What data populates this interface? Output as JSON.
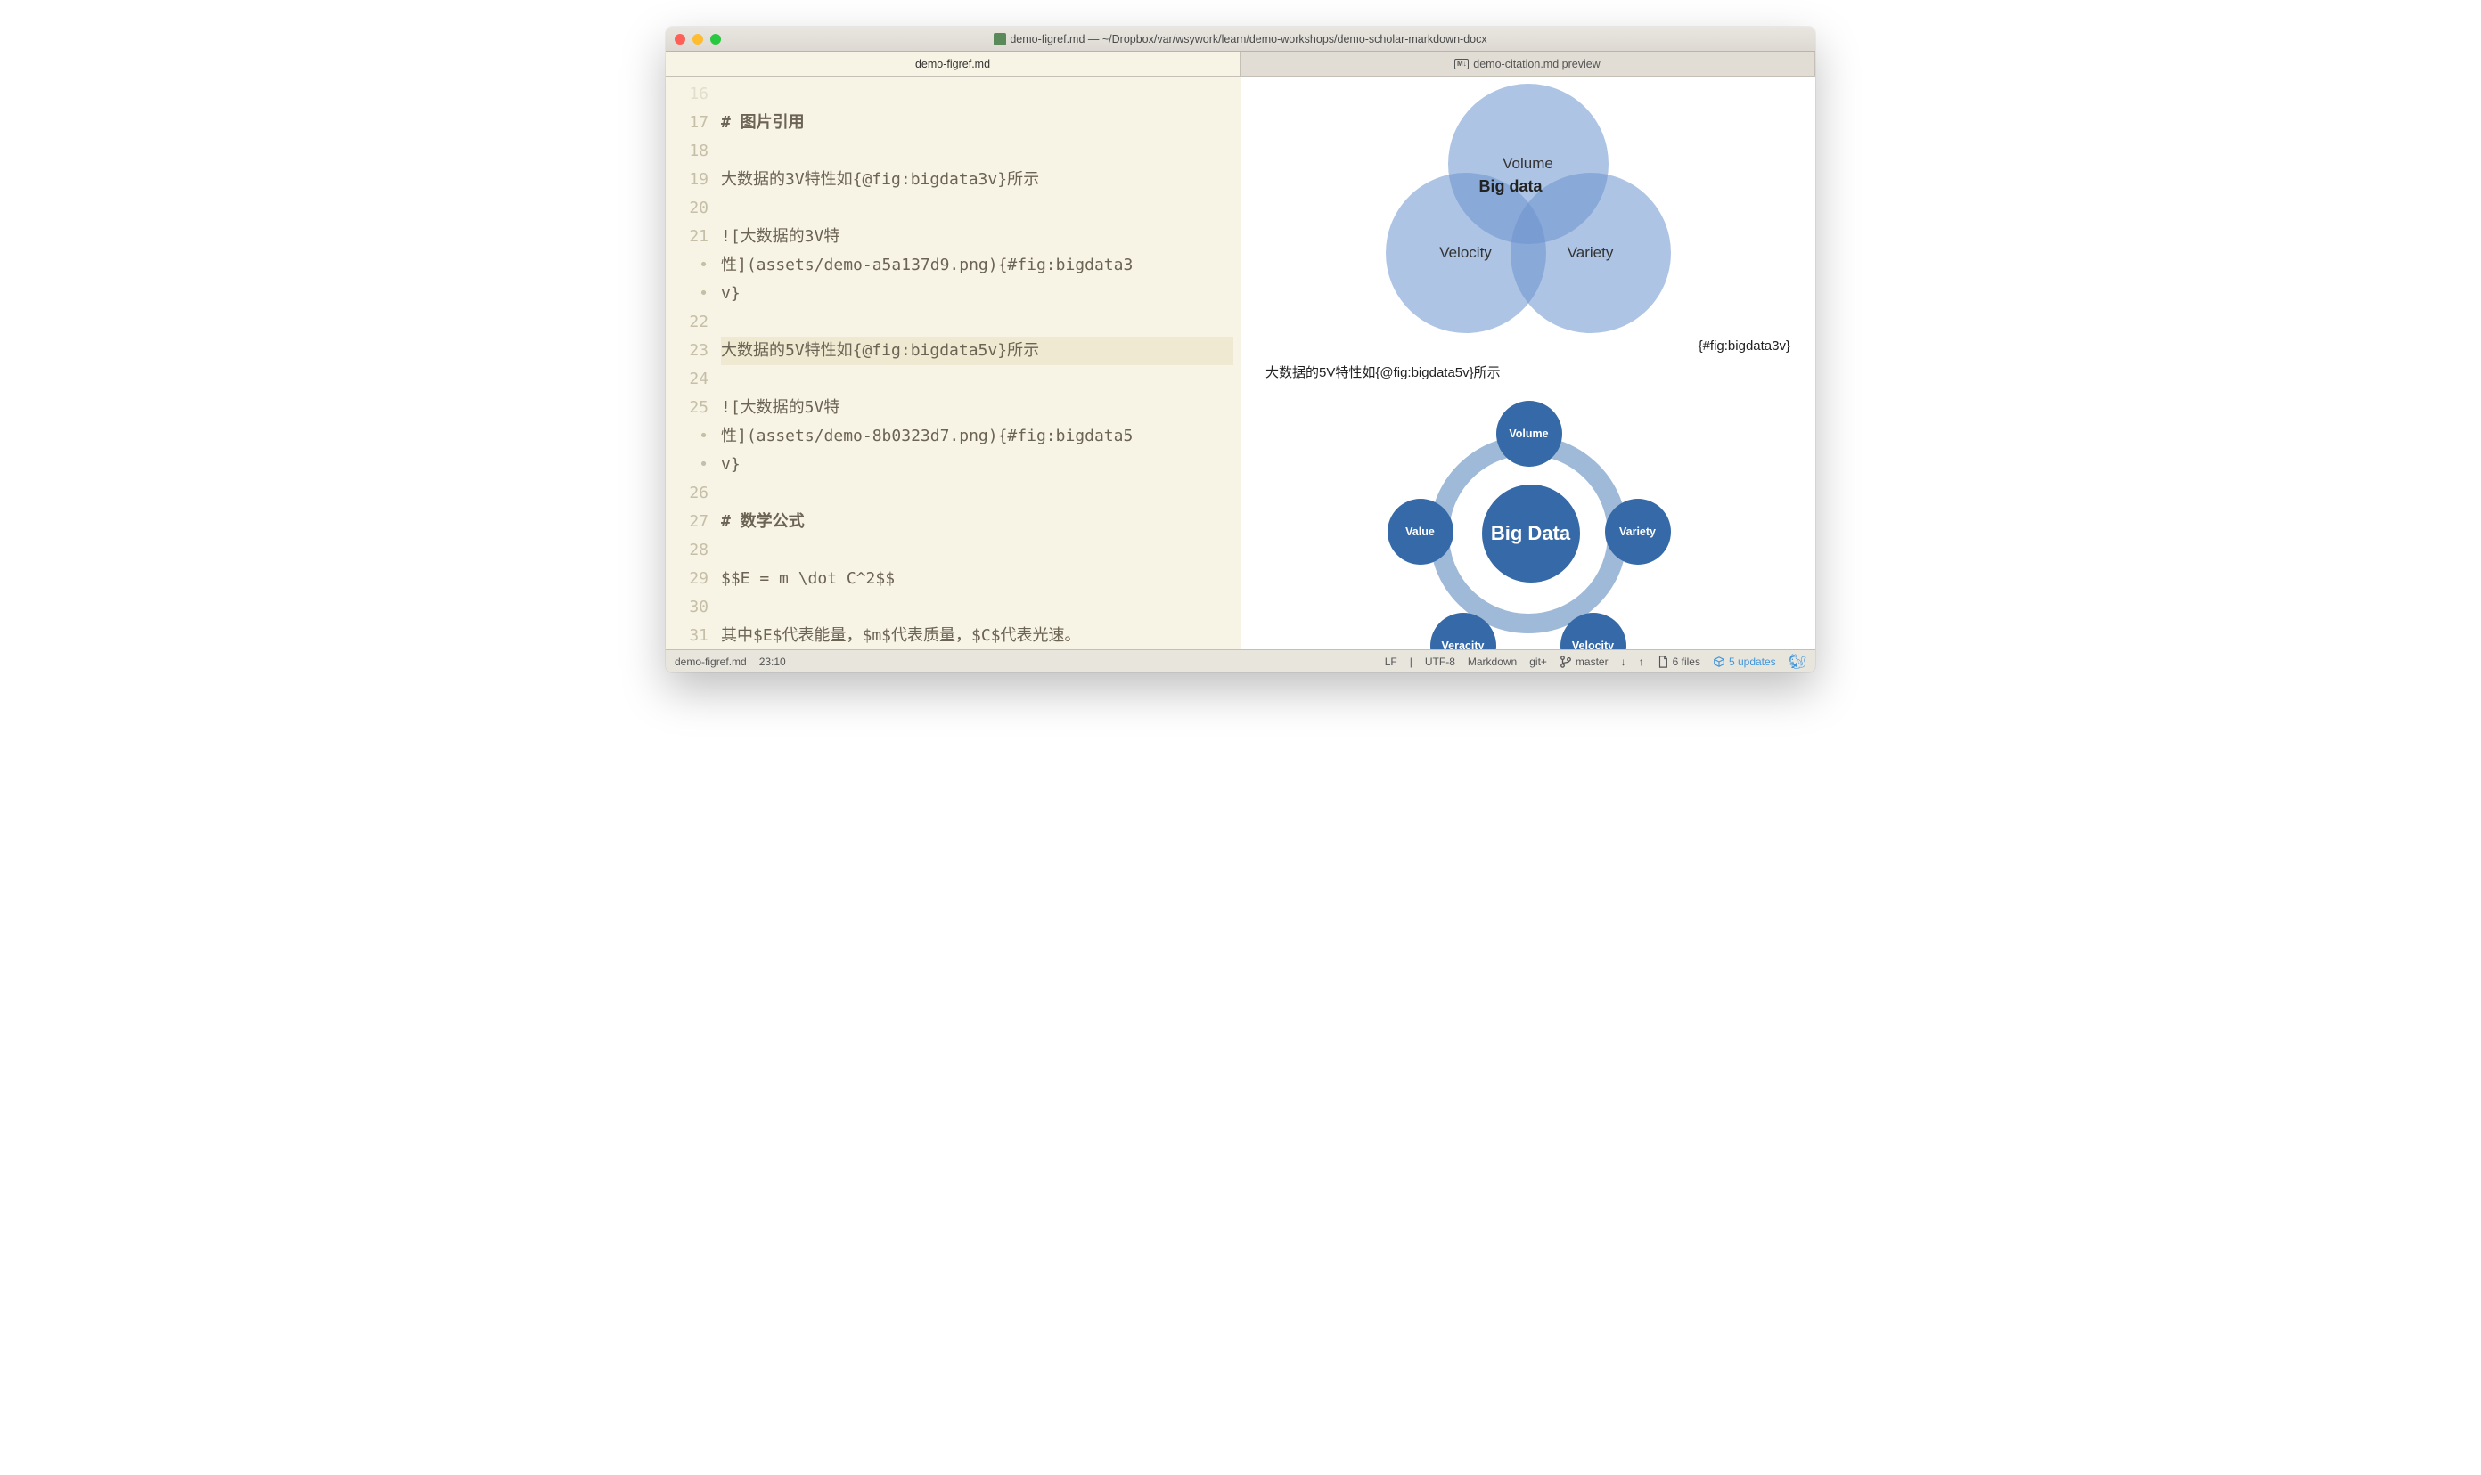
{
  "window": {
    "title": "demo-figref.md — ~/Dropbox/var/wsywork/learn/demo-workshops/demo-scholar-markdown-docx"
  },
  "tabs": {
    "left": "demo-figref.md",
    "right": "demo-citation.md preview"
  },
  "editor": {
    "gutter": [
      "16",
      "17",
      "18",
      "19",
      "20",
      "21",
      "•",
      "•",
      "22",
      "23",
      "24",
      "25",
      "•",
      "•",
      "26",
      "27",
      "28",
      "29",
      "30",
      "31"
    ],
    "line16_num": "16",
    "l17": "#  图片引用",
    "l19": "大数据的3V特性如{@fig:bigdata3v}所示",
    "l21a": "![大数据的3V特",
    "l21b": "性](assets/demo-a5a137d9.png){#fig:bigdata3",
    "l21c": "v}",
    "l23": "大数据的5V特性如{@fig:bigdata5v}所示",
    "l25a": "![大数据的5V特",
    "l25b": "性](assets/demo-8b0323d7.png){#fig:bigdata5",
    "l25c": "v}",
    "l27": "#  数学公式",
    "l29": "$$E = m \\dot C^2$$",
    "l31": "其中$E$代表能量，$m$代表质量，$C$代表光速。"
  },
  "preview": {
    "venn": {
      "c1": "Volume",
      "c2": "Velocity",
      "c3": "Variety",
      "center": "Big data"
    },
    "figtag": "{#fig:bigdata3v}",
    "text5v": "大数据的5V特性如{@fig:bigdata5v}所示",
    "wheel": {
      "hub": "Big Data",
      "n1": "Volume",
      "n2": "Variety",
      "n3": "Velocity",
      "n4": "Veracity",
      "n5": "Value"
    }
  },
  "status": {
    "file": "demo-figref.md",
    "cursor": "23:10",
    "eol": "LF",
    "sep": "|",
    "encoding": "UTF-8",
    "lang": "Markdown",
    "git": "git+",
    "branch": "master",
    "files": "6 files",
    "updates": "5 updates"
  }
}
